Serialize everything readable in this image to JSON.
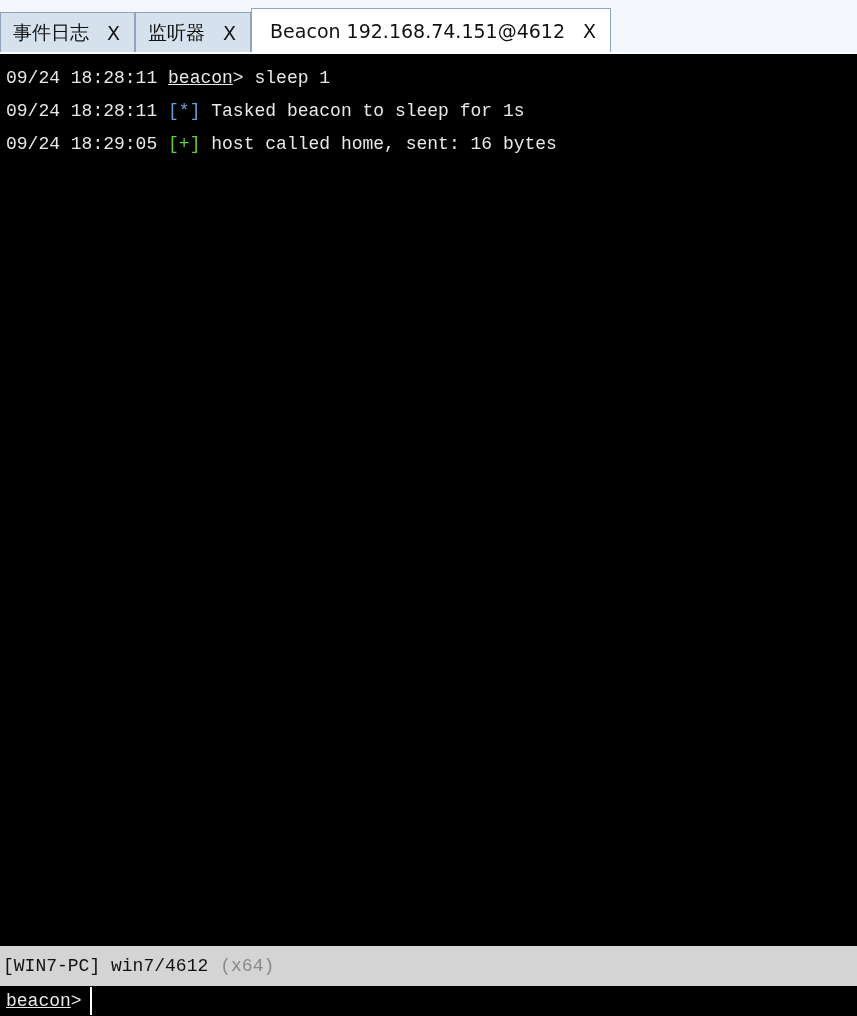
{
  "tabs": [
    {
      "label": "事件日志",
      "close": "X",
      "selected": false
    },
    {
      "label": "监听器",
      "close": "X",
      "selected": false
    },
    {
      "label": "Beacon 192.168.74.151@4612",
      "close": "X",
      "selected": true
    }
  ],
  "console": {
    "lines": [
      {
        "kind": "command",
        "time": "09/24 18:28:11",
        "prompt": "beacon",
        "prompt_sign": ">",
        "text": "sleep 1"
      },
      {
        "kind": "status",
        "time": "09/24 18:28:11",
        "marker": "[*]",
        "color": "#6a9fd8",
        "text": "Tasked beacon to sleep for 1s"
      },
      {
        "kind": "status",
        "time": "09/24 18:29:05",
        "marker": "[+]",
        "color": "#66cc33",
        "text": "host called home, sent: 16 bytes"
      }
    ]
  },
  "status_bar": {
    "host": "[WIN7-PC] win7/4612",
    "arch": "(x64)"
  },
  "input": {
    "prompt": "beacon",
    "prompt_sign": ">"
  }
}
